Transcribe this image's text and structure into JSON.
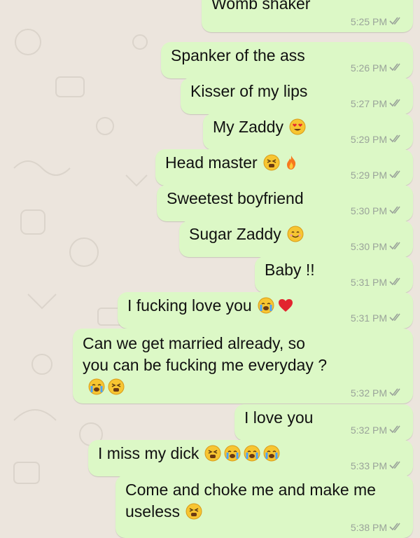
{
  "theme": {
    "bubble": "#DCF8C6",
    "background": "#ECE5DD",
    "tick": "#9aa39a"
  },
  "messages": [
    {
      "text": "Womb shaker",
      "time": "5:25 PM",
      "emoji": []
    },
    {
      "text": "Spanker of the ass",
      "time": "5:26 PM",
      "emoji": []
    },
    {
      "text": "Kisser of my lips",
      "time": "5:27 PM",
      "emoji": []
    },
    {
      "text": "My Zaddy",
      "time": "5:29 PM",
      "emoji": [
        "heart-eyes-emoji"
      ]
    },
    {
      "text": "Head master",
      "time": "5:29 PM",
      "emoji": [
        "tired-face-emoji",
        "fire-emoji"
      ]
    },
    {
      "text": "Sweetest boyfriend",
      "time": "5:30 PM",
      "emoji": []
    },
    {
      "text": "Sugar Zaddy",
      "time": "5:30 PM",
      "emoji": [
        "smiling-face-emoji"
      ]
    },
    {
      "text": "Baby !!",
      "time": "5:31 PM",
      "emoji": []
    },
    {
      "text": "I fucking love you",
      "time": "5:31 PM",
      "emoji": [
        "crying-face-emoji",
        "red-heart-emoji"
      ]
    },
    {
      "text": "Can we get married already, so you can be fucking me everyday ?",
      "time": "5:32 PM",
      "emoji": [
        "crying-face-emoji",
        "tired-face-emoji"
      ]
    },
    {
      "text": "I love you",
      "time": "5:32 PM",
      "emoji": []
    },
    {
      "text": "I miss my dick",
      "time": "5:33 PM",
      "emoji": [
        "tired-face-emoji",
        "crying-face-emoji",
        "crying-face-emoji",
        "crying-face-emoji"
      ]
    },
    {
      "text": "Come and choke me and make me useless",
      "time": "5:38 PM",
      "emoji": [
        "tired-face-emoji"
      ]
    }
  ]
}
